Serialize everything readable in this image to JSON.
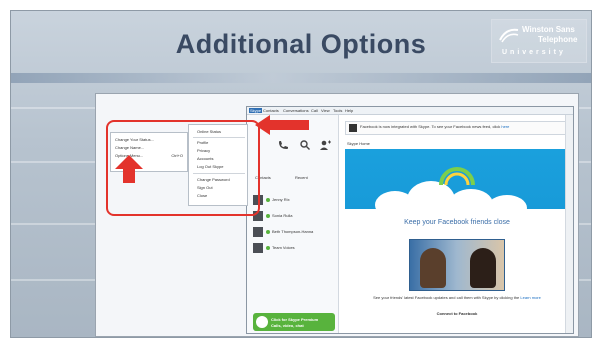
{
  "slide": {
    "title": "Additional Options",
    "logo": {
      "line1": "Winston Sans",
      "line2": "Telephone",
      "line3": "University"
    }
  },
  "screenshot": {
    "context_menu_left": {
      "items": [
        "Change Your Status...",
        "Change Name...",
        "Options Menu..."
      ],
      "shortcut": "Ctrl+O"
    },
    "dropdown_menu": {
      "items": [
        "Online Status",
        "Profile",
        "Privacy",
        "Accounts",
        "Log Out Skype",
        "Change Password",
        "Sign Out",
        "Close"
      ]
    },
    "app": {
      "menubar": [
        "Skype",
        "Contacts",
        "Conversations",
        "Call",
        "View",
        "Tools",
        "Help"
      ],
      "active_menu": "Skype",
      "tabs": [
        "Contacts",
        "Recent"
      ],
      "contacts": [
        "Jenny Rix",
        "Sonia Rulla",
        "Beth Thompson-Hanna",
        "Team Voices"
      ],
      "promo": {
        "line1": "Click for Skype Premium",
        "line2": "Calls, video, chat"
      },
      "notice": {
        "text": "Facebook is now integrated with Skype. To see your Facebook news feed, click",
        "link": "here"
      },
      "page_label": "Skype Home",
      "hero": {
        "headline": "Keep your Facebook friends close",
        "desc_text": "See your friends' latest Facebook updates and call them with Skype by clicking the ",
        "desc_link": "Learn more",
        "connect": "Connect to Facebook"
      }
    }
  },
  "colors": {
    "title": "#3a4a63",
    "highlight": "#e3332c",
    "arrow": "#e3332c",
    "skype_blue": "#1aa0dd",
    "promo_green": "#58b33d"
  }
}
